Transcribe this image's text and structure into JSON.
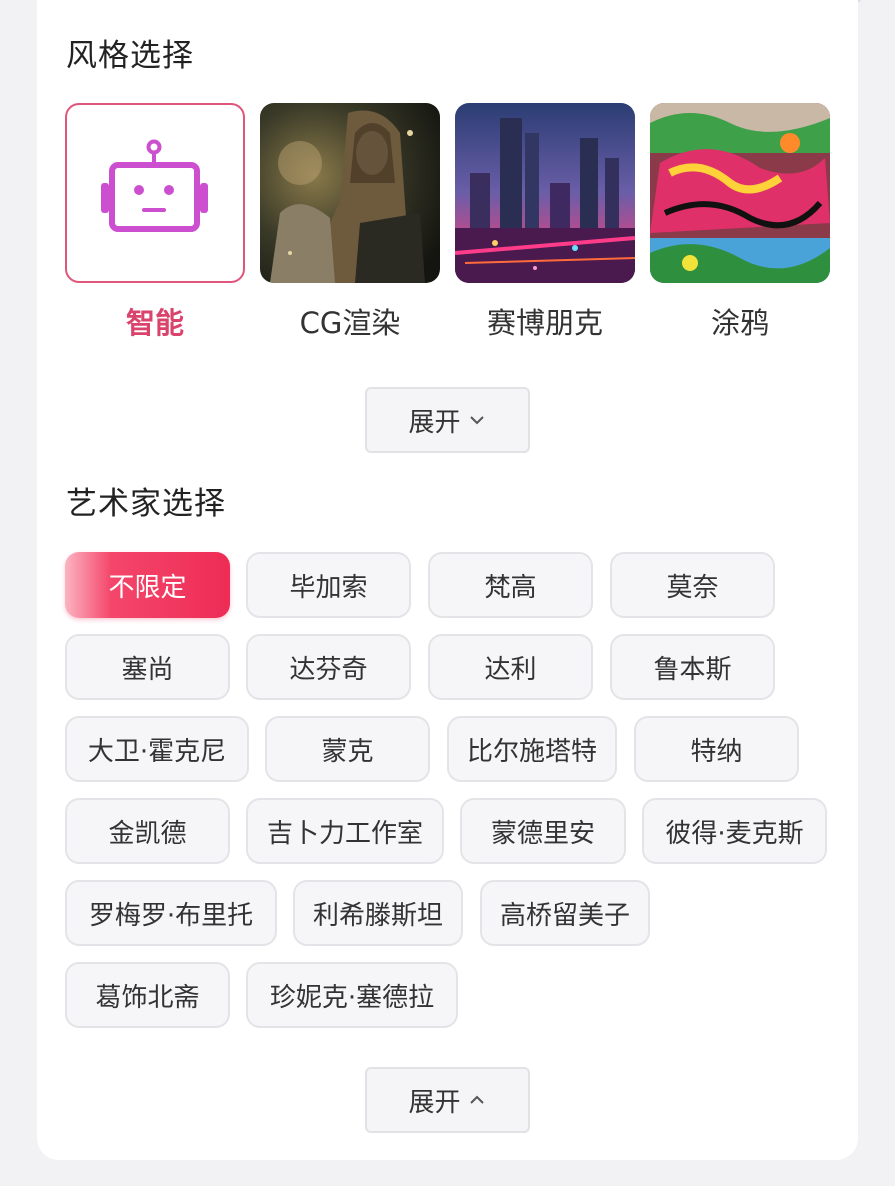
{
  "style_section": {
    "title": "风格选择",
    "items": [
      {
        "label": "智能",
        "selected": true,
        "icon": "robot-icon"
      },
      {
        "label": "CG渲染",
        "selected": false,
        "icon": "cg-render-thumbnail"
      },
      {
        "label": "赛博朋克",
        "selected": false,
        "icon": "cyberpunk-city-thumbnail"
      },
      {
        "label": "涂鸦",
        "selected": false,
        "icon": "graffiti-thumbnail"
      }
    ],
    "expand_label": "展开"
  },
  "artist_section": {
    "title": "艺术家选择",
    "chips": [
      "不限定",
      "毕加索",
      "梵高",
      "莫奈",
      "塞尚",
      "达芬奇",
      "达利",
      "鲁本斯",
      "大卫·霍克尼",
      "蒙克",
      "比尔施塔特",
      "特纳",
      "金凯德",
      "吉卜力工作室",
      "蒙德里安",
      "彼得·麦克斯",
      "罗梅罗·布里托",
      "利希滕斯坦",
      "高桥留美子",
      "葛饰北斋",
      "珍妮克·塞德拉"
    ],
    "active_index": 0,
    "collapse_label": "展开"
  },
  "colors": {
    "accent": "#e0557a",
    "active_chip": "#ee2c56",
    "chip_bg": "#f6f6f8"
  }
}
